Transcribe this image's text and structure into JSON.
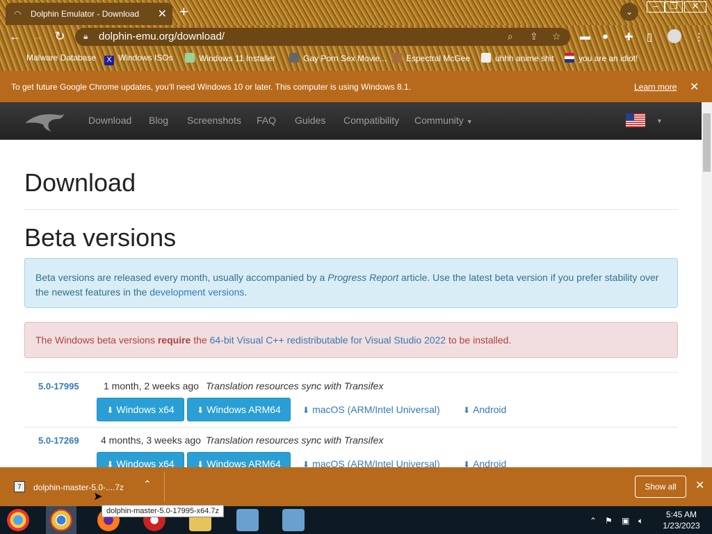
{
  "browser": {
    "tab_title": "Dolphin Emulator - Download",
    "url": "dolphin-emu.org/download/",
    "bookmarks": [
      {
        "label": "Malware Database"
      },
      {
        "label": "Windows ISOs"
      },
      {
        "label": "Windows 11 Installer"
      },
      {
        "label": "Gay Porn Sex Movie..."
      },
      {
        "label": "Espectral McGee"
      },
      {
        "label": "uhhh anime shit"
      },
      {
        "label": "you are an idiot!"
      }
    ],
    "infobar": {
      "message": "To get future Google Chrome updates, you'll need Windows 10 or later. This computer is using Windows 8.1.",
      "learn_more": "Learn more"
    }
  },
  "site": {
    "nav": [
      "Download",
      "Blog",
      "Screenshots",
      "FAQ",
      "Guides",
      "Compatibility",
      "Community"
    ],
    "page_title": "Download",
    "section_title": "Beta versions",
    "info_alert": {
      "part1": "Beta versions are released every month, usually accompanied by a ",
      "italic": "Progress Report",
      "part2": " article. Use the latest beta version if you prefer stability over the newest features in the ",
      "link": "development versions",
      "part3": "."
    },
    "danger_alert": {
      "part1": "The Windows beta versions ",
      "bold": "require",
      "part2": " the ",
      "link": "64-bit Visual C++ redistributable for Visual Studio 2022",
      "part3": " to be installed."
    },
    "versions": [
      {
        "version": "5.0-17995",
        "age": "1 month, 2 weeks ago",
        "message": "Translation resources sync with Transifex",
        "buttons": [
          "Windows x64",
          "Windows ARM64"
        ],
        "links": [
          "macOS (ARM/Intel Universal)",
          "Android"
        ]
      },
      {
        "version": "5.0-17269",
        "age": "4 months, 3 weeks ago",
        "message": "Translation resources sync with Transifex",
        "buttons": [
          "Windows x64",
          "Windows ARM64"
        ],
        "links": [
          "macOS (ARM/Intel Universal)",
          "Android"
        ]
      }
    ]
  },
  "download_shelf": {
    "file": "dolphin-master-5.0-....7z",
    "show_all": "Show all",
    "tooltip": "dolphin-master-5.0-17995-x64.7z"
  },
  "taskbar": {
    "time": "5:45 AM",
    "date": "1/23/2023"
  },
  "colors": {
    "accent_button": "#2a9fd6",
    "chrome_theme": "#b86a1c",
    "link": "#337ab7"
  }
}
